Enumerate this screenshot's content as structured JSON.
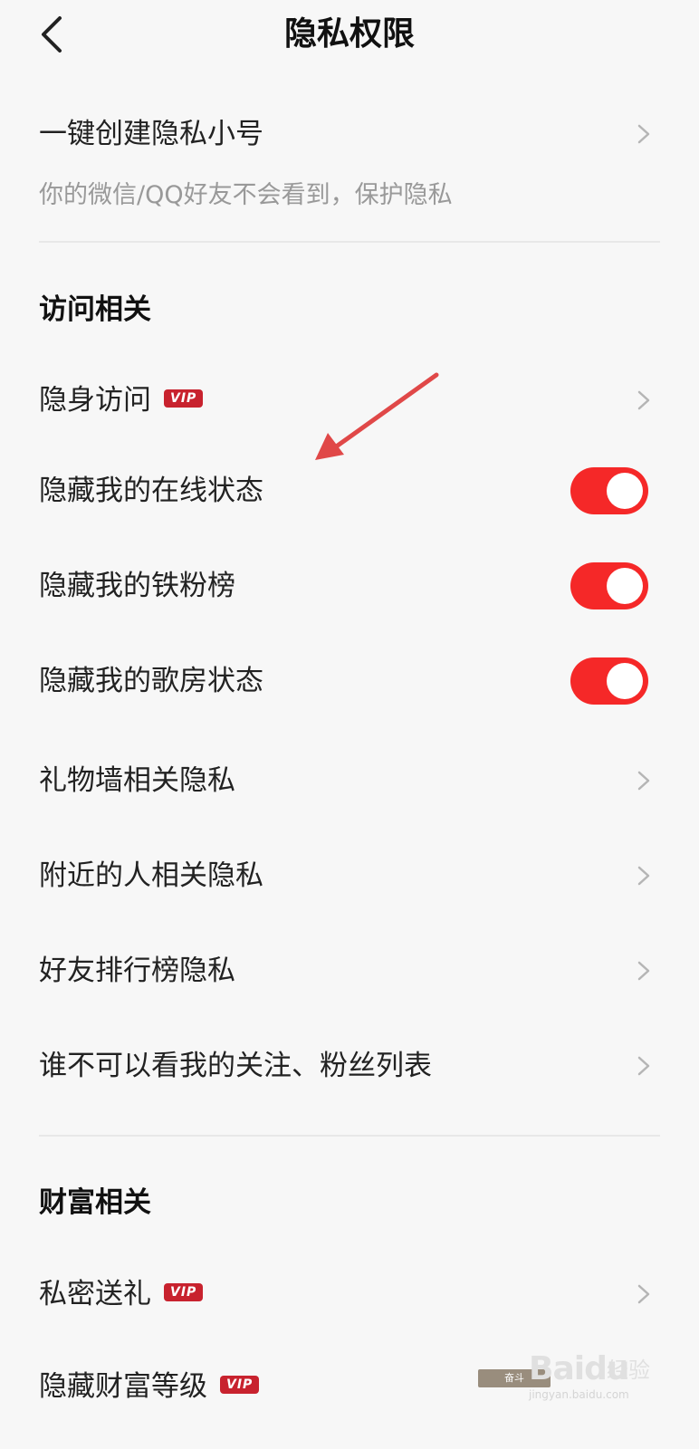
{
  "header": {
    "title": "隐私权限",
    "back_icon": "chevron-left-icon"
  },
  "alt_account": {
    "label": "一键创建隐私小号",
    "subtitle": "你的微信/QQ好友不会看到，保护隐私"
  },
  "access_section": {
    "title": "访问相关",
    "items": [
      {
        "label": "隐身访问",
        "badge": "VIP",
        "control": "chevron"
      },
      {
        "label": "隐藏我的在线状态",
        "control": "toggle",
        "on": true
      },
      {
        "label": "隐藏我的铁粉榜",
        "control": "toggle",
        "on": true
      },
      {
        "label": "隐藏我的歌房状态",
        "control": "toggle",
        "on": true
      },
      {
        "label": "礼物墙相关隐私",
        "control": "chevron"
      },
      {
        "label": "附近的人相关隐私",
        "control": "chevron"
      },
      {
        "label": "好友排行榜隐私",
        "control": "chevron"
      },
      {
        "label": "谁不可以看我的关注、粉丝列表",
        "control": "chevron"
      }
    ]
  },
  "wealth_section": {
    "title": "财富相关",
    "items": [
      {
        "label": "私密送礼",
        "badge": "VIP",
        "control": "chevron"
      },
      {
        "label": "隐藏财富等级",
        "badge": "VIP"
      }
    ]
  },
  "watermark": {
    "plaque": "奋斗",
    "logo": "Baidu",
    "jingyan": "经验",
    "url": "jingyan.baidu.com"
  },
  "colors": {
    "accent_toggle": "#f52828",
    "vip_badge": "#c8222e",
    "annotation_arrow": "#e04848",
    "background": "#f7f7f7"
  }
}
